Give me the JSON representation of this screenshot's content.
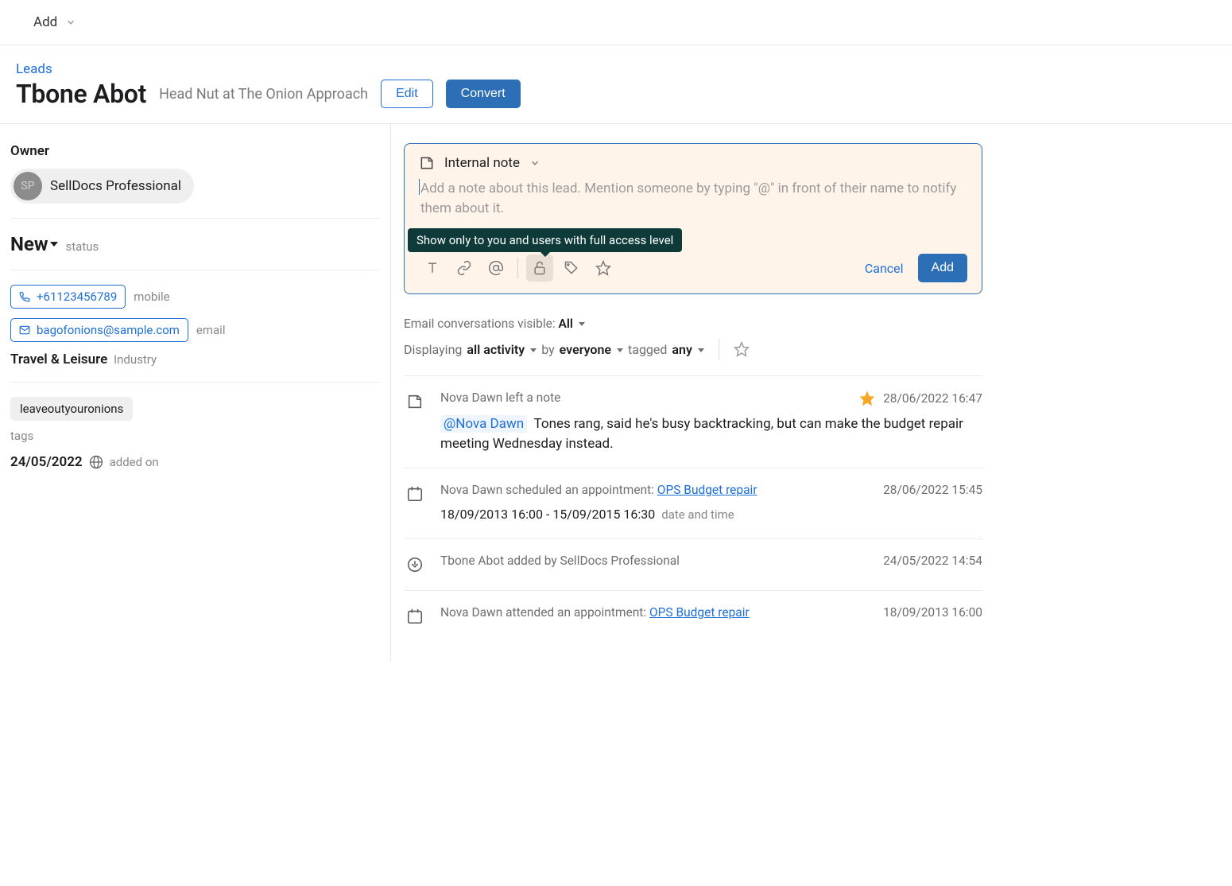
{
  "topbar": {
    "add_label": "Add"
  },
  "header": {
    "breadcrumb": "Leads",
    "name": "Tbone Abot",
    "subtitle": "Head Nut at The Onion Approach",
    "edit_label": "Edit",
    "convert_label": "Convert"
  },
  "left": {
    "owner_label": "Owner",
    "owner_initials": "SP",
    "owner_name": "SellDocs Professional",
    "status_value": "New",
    "status_label": "status",
    "phone": "+61123456789",
    "phone_type": "mobile",
    "email": "bagofonions@sample.com",
    "email_type": "email",
    "industry": "Travel & Leisure",
    "industry_label": "Industry",
    "tag": "leaveoutyouronions",
    "tags_label": "tags",
    "added_on_date": "24/05/2022",
    "added_on_label": "added on"
  },
  "compose": {
    "type_label": "Internal note",
    "placeholder": "Add a note about this lead. Mention someone by typing \"@\" in front of their name to notify them about it.",
    "tooltip": "Show only to you and users with full access level",
    "cancel_label": "Cancel",
    "add_label": "Add"
  },
  "filters": {
    "email_vis_prefix": "Email conversations visible: ",
    "email_vis_value": "All",
    "displaying": "Displaying",
    "all_activity": "all activity",
    "by": "by",
    "everyone": "everyone",
    "tagged": "tagged",
    "any": "any"
  },
  "activities": [
    {
      "icon": "note",
      "head": "Nova Dawn left a note",
      "starred": true,
      "ts": "28/06/2022 16:47",
      "mention": "@Nova Dawn",
      "body": "Tones rang, said he's busy backtracking, but can make the budget repair meeting Wednesday instead."
    },
    {
      "icon": "calendar",
      "head_prefix": "Nova Dawn scheduled an appointment: ",
      "head_link": "OPS Budget repair",
      "ts": "28/06/2022 15:45",
      "sub_value": "18/09/2013 16:00 - 15/09/2015 16:30",
      "sub_label": "date and time"
    },
    {
      "icon": "added",
      "head": "Tbone Abot added by SellDocs Professional",
      "ts": "24/05/2022 14:54"
    },
    {
      "icon": "calendar",
      "head_prefix": "Nova Dawn attended an appointment: ",
      "head_link": "OPS Budget repair",
      "ts": "18/09/2013 16:00"
    }
  ]
}
